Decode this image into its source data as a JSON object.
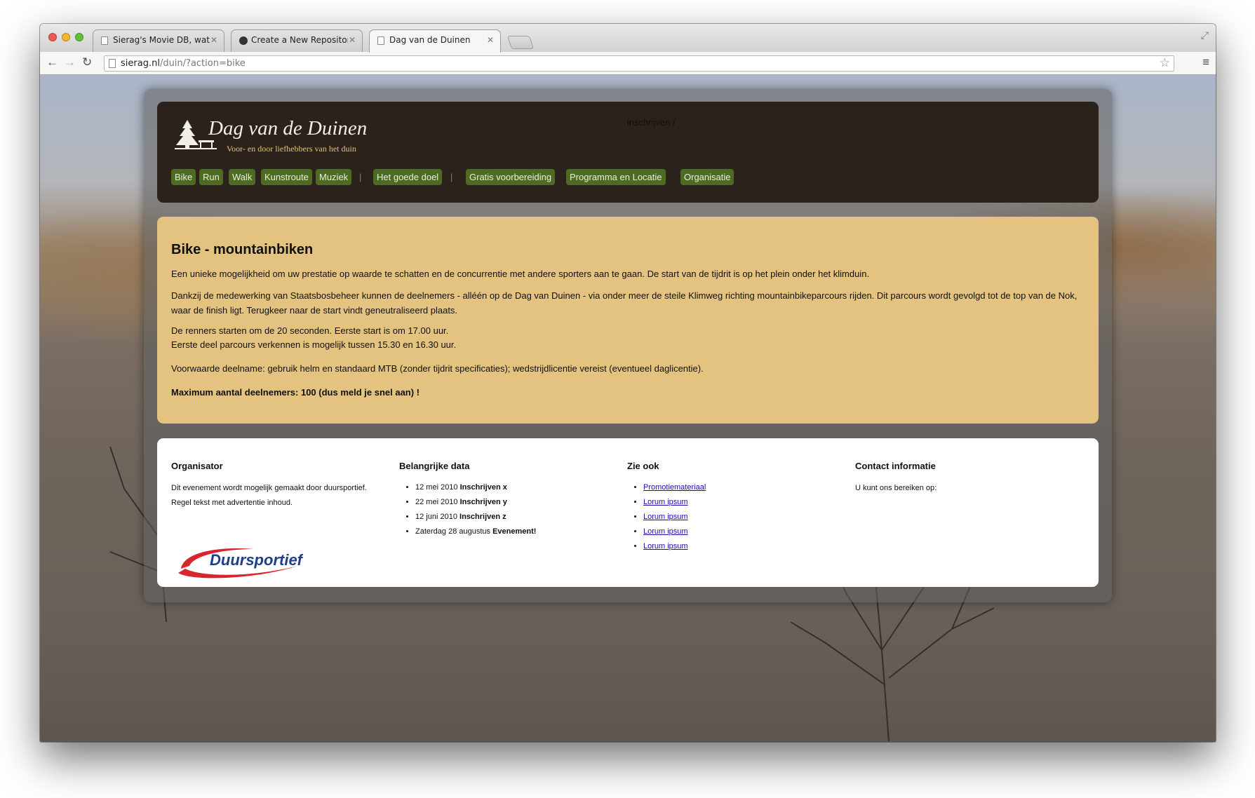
{
  "browser": {
    "tabs": [
      {
        "title": "Sierag's Movie DB, watche",
        "active": false
      },
      {
        "title": "Create a New Repository",
        "active": false
      },
      {
        "title": "Dag van de Duinen",
        "active": true
      }
    ],
    "url_host": "sierag.nl",
    "url_path": "/duin/?action=bike"
  },
  "site": {
    "title": "Dag van de Duinen",
    "tagline": "Voor- en door liefhebbers van het duin",
    "breadcrumb": "inschrijven /",
    "nav": [
      {
        "label": "Bike"
      },
      {
        "label": "Run"
      },
      {
        "label": "Walk"
      },
      {
        "label": "Kunstroute"
      },
      {
        "label": "Muziek"
      },
      {
        "label": "Het goede doel"
      },
      {
        "label": "Gratis voorbereiding"
      },
      {
        "label": "Programma en Locatie"
      },
      {
        "label": "Organisatie"
      }
    ],
    "nav_separator": "|"
  },
  "content": {
    "heading": "Bike - mountainbiken",
    "p1": "Een unieke mogelijkheid om uw prestatie op waarde te schatten en de concurrentie met andere sporters aan te gaan. De start van de tijdrit is op het plein onder het klimduin.",
    "p2": "Dankzij de medewerking van Staatsbosbeheer kunnen de deelnemers - alléén op de Dag van Duinen - via onder meer de steile Klimweg richting mountainbikeparcours rijden. Dit parcours wordt gevolgd tot de top van de Nok, waar de finish ligt. Terugkeer naar de start vindt geneutraliseerd plaats.",
    "p3a": "De renners starten om de 20 seconden. Eerste start is om 17.00 uur.",
    "p3b": "Eerste deel parcours verkennen is mogelijk tussen 15.30 en 16.30 uur.",
    "p4": "Voorwaarde deelname: gebruik helm en standaard MTB (zonder tijdrit specificaties); wedstrijdlicentie vereist (eventueel daglicentie).",
    "p5": "Maximum aantal deelnemers: 100 (dus meld je snel aan) !"
  },
  "footer": {
    "organisator": {
      "title": "Organisator",
      "text": "Dit evenement wordt mogelijk gemaakt door duursportief. Regel tekst met advertentie inhoud.",
      "logo_text": "Duursportief"
    },
    "data": {
      "title": "Belangrijke data",
      "items": [
        {
          "date": "12 mei 2010",
          "label": "Inschrijven x"
        },
        {
          "date": "22 mei 2010",
          "label": "Inschrijven y"
        },
        {
          "date": "12 juni 2010",
          "label": "Inschrijven z"
        },
        {
          "date": "Zaterdag 28 augustus",
          "label": "Evenement!"
        }
      ]
    },
    "zie_ook": {
      "title": "Zie ook",
      "links": [
        "Promotiemateriaal",
        "Lorum ipsum",
        "Lorum ipsum",
        "Lorum ipsum",
        "Lorum ipsum"
      ]
    },
    "contact": {
      "title": "Contact informatie",
      "text": "U kunt ons bereiken op:"
    }
  },
  "colors": {
    "nav_bg": "#4e6b23",
    "header_bg": "#2b221c",
    "content_bg": "#e4c280",
    "tagline": "#e2c27b",
    "link": "#1a0dab"
  }
}
